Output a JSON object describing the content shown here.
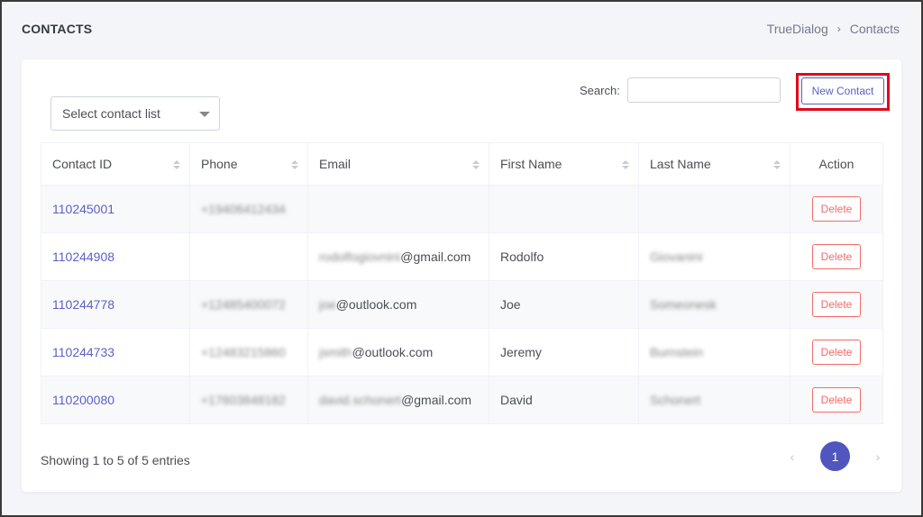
{
  "header": {
    "title": "CONTACTS",
    "breadcrumb": [
      "TrueDialog",
      "Contacts"
    ],
    "breadcrumb_sep": "›"
  },
  "toolbar": {
    "select_placeholder": "Select contact list",
    "search_label": "Search:",
    "search_value": "",
    "new_contact_label": "New Contact"
  },
  "table": {
    "columns": [
      "Contact ID",
      "Phone",
      "Email",
      "First Name",
      "Last Name",
      "Action"
    ],
    "rows": [
      {
        "id": "110245001",
        "phone": "+19406412434",
        "email_blur": "",
        "email_domain": "",
        "first": "",
        "last": ""
      },
      {
        "id": "110244908",
        "phone": "",
        "email_blur": "rodolfogiovnini",
        "email_domain": "@gmail.com",
        "first": "Rodolfo",
        "last": "Giovanini"
      },
      {
        "id": "110244778",
        "phone": "+12485400072",
        "email_blur": "joe",
        "email_domain": "@outlook.com",
        "first": "Joe",
        "last": "Someonesk"
      },
      {
        "id": "110244733",
        "phone": "+12483215860",
        "email_blur": "jsmith",
        "email_domain": "@outlook.com",
        "first": "Jeremy",
        "last": "Burnstein"
      },
      {
        "id": "110200080",
        "phone": "+17603848182",
        "email_blur": "david.schonert",
        "email_domain": "@gmail.com",
        "first": "David",
        "last": "Schonert"
      }
    ],
    "delete_label": "Delete"
  },
  "footer": {
    "showing": "Showing 1 to 5 of 5 entries",
    "prev": "‹",
    "page": "1",
    "next": "›"
  },
  "colors": {
    "accent": "#5156be",
    "link": "#5b5fc7",
    "danger": "#f46a6a",
    "highlight": "#e1081c"
  }
}
